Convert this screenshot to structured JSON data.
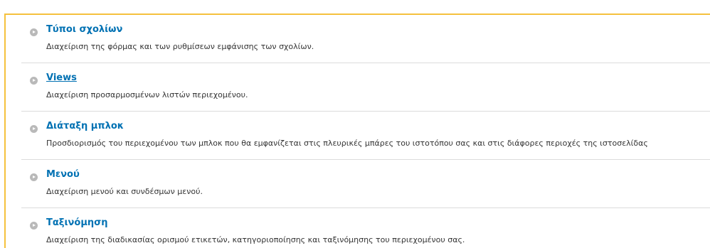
{
  "colors": {
    "link": "#0071b3",
    "description": "#333333",
    "accent_border": "#f5c13d",
    "divider": "#dcdcdc",
    "bullet": "#b9b9b9"
  },
  "items": [
    {
      "icon": "arrow-right-circle-icon",
      "title": "Τύποι σχολίων",
      "description": "Διαχείριση της φόρμας και των ρυθμίσεων εμφάνισης των σχολίων."
    },
    {
      "icon": "arrow-right-circle-icon",
      "title": "Views",
      "description": "Διαχείριση προσαρμοσμένων λιστών περιεχομένου."
    },
    {
      "icon": "arrow-right-circle-icon",
      "title": "Διάταξη μπλοκ",
      "description": "Προσδιορισμός του περιεχομένου των μπλοκ που θα εμφανίζεται στις πλευρικές μπάρες του ιστοτόπου σας και στις διάφορες περιοχές της ιστοσελίδας"
    },
    {
      "icon": "arrow-right-circle-icon",
      "title": "Μενού",
      "description": "Διαχείριση μενού και συνδέσμων μενού."
    },
    {
      "icon": "arrow-right-circle-icon",
      "title": "Ταξινόμηση",
      "description": "Διαχείριση της διαδικασίας ορισμού ετικετών, κατηγοριοποίησης και ταξινόμησης του περιεχομένου σας."
    }
  ]
}
